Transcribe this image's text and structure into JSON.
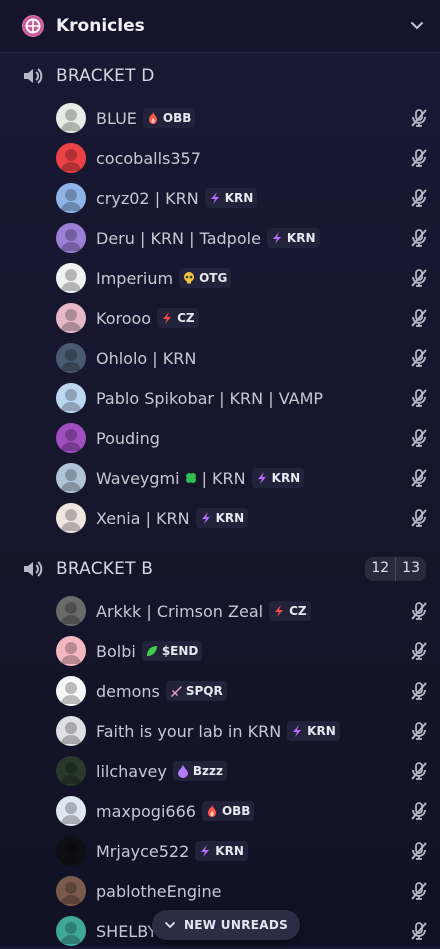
{
  "server": {
    "name": "Kronicles",
    "icon": "kronicles-server-icon"
  },
  "channels": [
    {
      "name": "BRACKET D",
      "icon": "speaker-stage-icon",
      "users": [
        {
          "name": "BLUE",
          "tag": "OBB",
          "tag_icon": "fire-icon",
          "avatar": "#e8ece6"
        },
        {
          "name": "cocoballs357",
          "avatar": "#ed4245"
        },
        {
          "name": "cryz02 | KRN",
          "tag": "KRN",
          "tag_icon": "lightning-icon",
          "avatar": "#8fb4e8"
        },
        {
          "name": "Deru | KRN | Tadpole",
          "tag": "KRN",
          "tag_icon": "lightning-icon",
          "avatar": "#9a7fd4"
        },
        {
          "name": "Imperium",
          "tag": "OTG",
          "tag_icon": "skull-icon",
          "avatar": "#f2f2f2"
        },
        {
          "name": "Korooo",
          "tag": "CZ",
          "tag_icon": "bolt-red-icon",
          "avatar": "#e6b8c8"
        },
        {
          "name": "Ohlolo | KRN",
          "avatar": "#4a5a70"
        },
        {
          "name": "Pablo Spikobar | KRN | VAMP",
          "avatar": "#bcd8f0"
        },
        {
          "name": "Pouding",
          "avatar": "#a04ec0"
        },
        {
          "name": "Waveygmi",
          "suffix": " | KRN",
          "emoji": "clover-icon",
          "tag": "KRN",
          "tag_icon": "lightning-icon",
          "avatar": "#b0c4d8"
        },
        {
          "name": "Xenia | KRN",
          "tag": "KRN",
          "tag_icon": "lightning-icon",
          "avatar": "#f0e6e0"
        }
      ]
    },
    {
      "name": "BRACKET B",
      "icon": "speaker-stage-icon",
      "count": "12",
      "limit": "13",
      "users": [
        {
          "name": "Arkkk | Crimson Zeal",
          "tag": "CZ",
          "tag_icon": "bolt-red-icon",
          "avatar": "#6a6a6a"
        },
        {
          "name": "Bolbi",
          "tag": "$END",
          "tag_icon": "leaf-icon",
          "avatar": "#f4b8c0"
        },
        {
          "name": "demons",
          "tag": "SPQR",
          "tag_icon": "sword-icon",
          "avatar": "#f8f8f8"
        },
        {
          "name": "Faith is your lab in KRN",
          "tag": "KRN",
          "tag_icon": "lightning-icon",
          "avatar": "#e0e0e4"
        },
        {
          "name": "lilchavey",
          "tag": "Bzzz",
          "tag_icon": "drop-purple-icon",
          "avatar": "#2a3a2a"
        },
        {
          "name": "maxpogi666",
          "tag": "OBB",
          "tag_icon": "fire-icon",
          "avatar": "#dfe8f2"
        },
        {
          "name": "Mrjayce522",
          "tag": "KRN",
          "tag_icon": "lightning-icon",
          "avatar": "#101014"
        },
        {
          "name": "pablotheEngine",
          "avatar": "#7a5a4a"
        },
        {
          "name": "SHELBY",
          "avatar": "#3fa89a"
        }
      ]
    }
  ],
  "new_unreads_label": "NEW UNREADS",
  "colors": {
    "accent_fire": "#ff5a4a",
    "accent_krn": "#b86cff",
    "accent_cz": "#ff4d4d",
    "muted_icon": "#b5b5c4"
  }
}
